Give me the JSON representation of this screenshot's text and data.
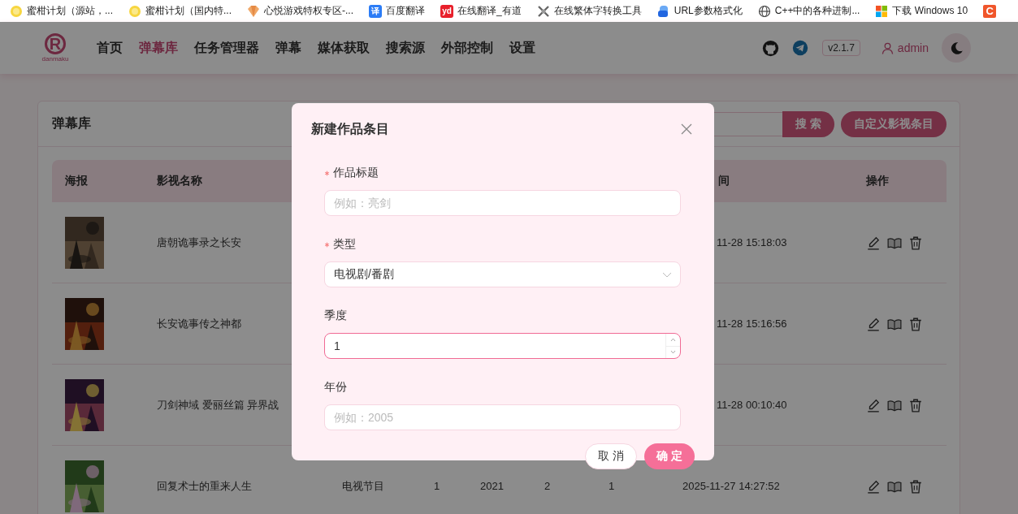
{
  "bookmarks": [
    {
      "label": "蜜柑计划（源站，...",
      "kind": "citrus"
    },
    {
      "label": "蜜柑计划（国内特...",
      "kind": "citrus"
    },
    {
      "label": "心悦游戏特权专区-...",
      "kind": "gem"
    },
    {
      "label": "百度翻译",
      "kind": "translate",
      "mark": "译"
    },
    {
      "label": "在线翻译_有道",
      "kind": "youdao",
      "mark": "yd"
    },
    {
      "label": "在线繁体字转换工具",
      "kind": "knot"
    },
    {
      "label": "URL参数格式化",
      "kind": "cloud"
    },
    {
      "label": "C++中的各种进制...",
      "kind": "globe"
    },
    {
      "label": "下载 Windows 10",
      "kind": "windows"
    },
    {
      "kind": "letter",
      "mark": "C"
    }
  ],
  "nav": {
    "logo_mark": "R",
    "logo_text": "danmaku",
    "items": [
      {
        "label": "首页",
        "selected": false
      },
      {
        "label": "弹幕库",
        "selected": true
      },
      {
        "label": "任务管理器",
        "selected": false
      },
      {
        "label": "弹幕",
        "selected": false
      },
      {
        "label": "媒体获取",
        "selected": false
      },
      {
        "label": "搜索源",
        "selected": false
      },
      {
        "label": "外部控制",
        "selected": false
      },
      {
        "label": "设置",
        "selected": false
      }
    ],
    "version": "v2.1.7",
    "user": "admin"
  },
  "library": {
    "title": "弹幕库",
    "search_button": "搜 索",
    "custom_button": "自定义影视条目",
    "columns": {
      "poster": "海报",
      "name": "影视名称",
      "time": "间",
      "actions": "操作"
    },
    "rows": [
      {
        "name": "唐朝诡事录之长安",
        "time": "11-28 15:18:03"
      },
      {
        "name": "长安诡事传之神都",
        "time": "11-28 15:16:56"
      },
      {
        "name": "刀剑神域 爱丽丝篇 异界战",
        "time": "11-28 00:10:40"
      },
      {
        "name": "回复术士的重来人生",
        "type": "电视节目",
        "season": "1",
        "year": "2021",
        "column_6": "2",
        "column_7": "1",
        "time": "2025-11-27 14:27:52"
      }
    ]
  },
  "dialog": {
    "title": "新建作品条目",
    "fields": [
      {
        "label": "作品标题",
        "required": true,
        "kind": "text",
        "placeholder": "例如：亮剑",
        "focused": false
      },
      {
        "label": "类型",
        "required": true,
        "kind": "select",
        "value": "电视剧/番剧",
        "focused": false
      },
      {
        "label": "季度",
        "required": false,
        "kind": "number",
        "value": "1",
        "focused": true
      },
      {
        "label": "年份",
        "required": false,
        "kind": "text",
        "placeholder": "例如：2005",
        "focused": false
      }
    ],
    "buttons": [
      {
        "label": "取 消",
        "kind": "secondary"
      },
      {
        "label": "确 定",
        "kind": "primary"
      }
    ]
  }
}
